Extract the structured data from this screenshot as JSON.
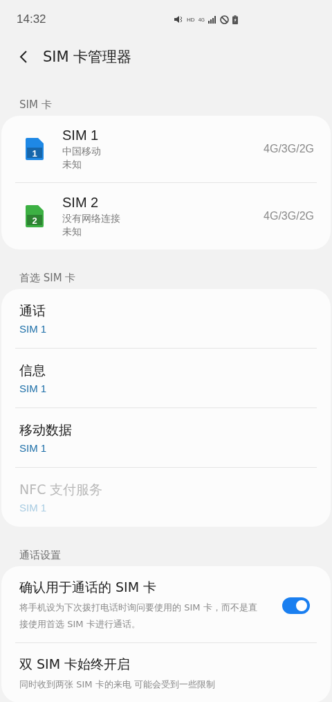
{
  "status_bar": {
    "time": "14:32",
    "hd": "HD",
    "network": "4G"
  },
  "header": {
    "title": "SIM 卡管理器"
  },
  "sim_section": {
    "title": "SIM 卡",
    "cards": [
      {
        "number": "1",
        "name": "SIM 1",
        "carrier": "中国移动",
        "status": "未知",
        "mode": "4G/3G/2G",
        "color": "#1e88e5"
      },
      {
        "number": "2",
        "name": "SIM 2",
        "carrier": "没有网络连接",
        "status": "未知",
        "mode": "4G/3G/2G",
        "color": "#3cb043"
      }
    ]
  },
  "preferred_section": {
    "title": "首选 SIM 卡",
    "items": [
      {
        "label": "通话",
        "value": "SIM 1",
        "disabled": false
      },
      {
        "label": "信息",
        "value": "SIM 1",
        "disabled": false
      },
      {
        "label": "移动数据",
        "value": "SIM 1",
        "disabled": false
      },
      {
        "label": "NFC 支付服务",
        "value": "SIM 1",
        "disabled": true
      }
    ]
  },
  "call_section": {
    "title": "通话设置",
    "items": [
      {
        "kind": "switch",
        "label": "确认用于通话的 SIM 卡",
        "description": "将手机设为下次拨打电话时询问要使用的 SIM 卡，而不是直接使用首选 SIM 卡进行通话。",
        "on": true
      },
      {
        "kind": "plain",
        "label": "双 SIM 卡始终开启",
        "description": "同时收到两张 SIM 卡的来电 可能会受到一些限制"
      }
    ]
  }
}
